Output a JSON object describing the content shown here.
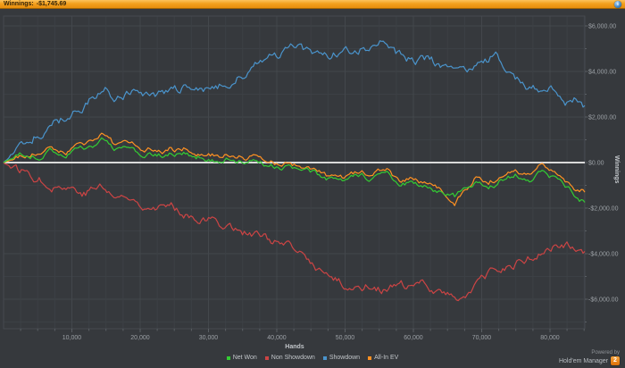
{
  "titlebar": {
    "label": "Winnings:",
    "value": "-$1,745.69"
  },
  "footer": {
    "powered_by": "Powered by",
    "brand": "Hold'em Manager",
    "badge": "2"
  },
  "colors": {
    "background": "#36393d",
    "titlebar_orange": "#f3a01e",
    "grid_minor": "#3c4045",
    "grid_major": "#43474c",
    "plot_border": "#45494e",
    "zero_line": "#d9d9d9",
    "axis_text": "#9ba0a5",
    "tick": "#5a5f64",
    "info_icon_blue": "#3b82c4",
    "badge_orange": "#e8820e"
  },
  "chart_data": {
    "type": "line",
    "title": "Winnings: -$1,745.69",
    "xlabel": "Hands",
    "ylabel": "Winnings",
    "xlim": [
      0,
      85100
    ],
    "ylim": [
      -7295,
      6430
    ],
    "grid": {
      "x_minor_step": 2500,
      "y_minor_step": 1000,
      "grid_on": true
    },
    "legend_position": "bottom-center",
    "zero_line": true,
    "x_ticks": [
      {
        "v": 10000,
        "label": "10,000"
      },
      {
        "v": 20000,
        "label": "20,000"
      },
      {
        "v": 30000,
        "label": "30,000"
      },
      {
        "v": 40000,
        "label": "40,000"
      },
      {
        "v": 50000,
        "label": "50,000"
      },
      {
        "v": 60000,
        "label": "60,000"
      },
      {
        "v": 70000,
        "label": "70,000"
      },
      {
        "v": 80000,
        "label": "80,000"
      }
    ],
    "y_ticks": [
      {
        "v": 6000,
        "label": "$6,000.00"
      },
      {
        "v": 4000,
        "label": "$4,000.00"
      },
      {
        "v": 2000,
        "label": "$2,000.00"
      },
      {
        "v": 0,
        "label": "$0.00"
      },
      {
        "v": -2000,
        "label": "-$2,000.00"
      },
      {
        "v": -4000,
        "label": "-$4,000.00"
      },
      {
        "v": -6000,
        "label": "-$6,000.00"
      }
    ],
    "series": [
      {
        "name": "Net Won",
        "color": "#33cc33",
        "points": [
          [
            0,
            0
          ],
          [
            1500,
            250
          ],
          [
            3000,
            350
          ],
          [
            5000,
            250
          ],
          [
            7000,
            450
          ],
          [
            9000,
            400
          ],
          [
            11000,
            550
          ],
          [
            13000,
            820
          ],
          [
            14500,
            950
          ],
          [
            16000,
            650
          ],
          [
            18000,
            550
          ],
          [
            20000,
            350
          ],
          [
            22000,
            280
          ],
          [
            24000,
            320
          ],
          [
            26000,
            400
          ],
          [
            28000,
            300
          ],
          [
            30000,
            200
          ],
          [
            32000,
            100
          ],
          [
            34000,
            150
          ],
          [
            36000,
            50
          ],
          [
            38000,
            -50
          ],
          [
            40000,
            -150
          ],
          [
            42000,
            -250
          ],
          [
            44000,
            -400
          ],
          [
            46000,
            -550
          ],
          [
            48000,
            -750
          ],
          [
            50000,
            -900
          ],
          [
            52000,
            -600
          ],
          [
            54000,
            -750
          ],
          [
            56000,
            -550
          ],
          [
            58000,
            -850
          ],
          [
            60000,
            -950
          ],
          [
            62000,
            -1050
          ],
          [
            64000,
            -1250
          ],
          [
            66000,
            -1500
          ],
          [
            67500,
            -1250
          ],
          [
            69000,
            -950
          ],
          [
            71000,
            -1050
          ],
          [
            73000,
            -750
          ],
          [
            75000,
            -500
          ],
          [
            77000,
            -650
          ],
          [
            79000,
            -450
          ],
          [
            80500,
            -700
          ],
          [
            82000,
            -950
          ],
          [
            83500,
            -1350
          ],
          [
            85000,
            -1745.69
          ]
        ]
      },
      {
        "name": "Non Showdown",
        "color": "#cc4444",
        "points": [
          [
            0,
            0
          ],
          [
            2000,
            -300
          ],
          [
            4000,
            -500
          ],
          [
            6000,
            -800
          ],
          [
            8000,
            -1000
          ],
          [
            10000,
            -1100
          ],
          [
            12000,
            -1300
          ],
          [
            14000,
            -1020
          ],
          [
            16000,
            -1450
          ],
          [
            18000,
            -1600
          ],
          [
            20000,
            -1750
          ],
          [
            22500,
            -1850
          ],
          [
            25000,
            -2000
          ],
          [
            27500,
            -2250
          ],
          [
            30000,
            -2500
          ],
          [
            32500,
            -2700
          ],
          [
            35000,
            -3000
          ],
          [
            37500,
            -3250
          ],
          [
            40000,
            -3500
          ],
          [
            42500,
            -3900
          ],
          [
            45000,
            -4400
          ],
          [
            47500,
            -5000
          ],
          [
            50000,
            -5400
          ],
          [
            52000,
            -5500
          ],
          [
            54000,
            -5300
          ],
          [
            56000,
            -5600
          ],
          [
            58000,
            -5450
          ],
          [
            60000,
            -5550
          ],
          [
            62000,
            -5350
          ],
          [
            64000,
            -5650
          ],
          [
            66000,
            -5950
          ],
          [
            67500,
            -5800
          ],
          [
            69000,
            -5400
          ],
          [
            71000,
            -5000
          ],
          [
            73000,
            -4700
          ],
          [
            75000,
            -4450
          ],
          [
            77000,
            -4200
          ],
          [
            79000,
            -3950
          ],
          [
            80500,
            -3750
          ],
          [
            82000,
            -3600
          ],
          [
            83500,
            -3800
          ],
          [
            85000,
            -3900
          ]
        ]
      },
      {
        "name": "Showdown",
        "color": "#4a94cc",
        "points": [
          [
            0,
            0
          ],
          [
            2000,
            600
          ],
          [
            4000,
            1100
          ],
          [
            6000,
            1500
          ],
          [
            8000,
            1800
          ],
          [
            10000,
            2100
          ],
          [
            12000,
            2600
          ],
          [
            14000,
            3100
          ],
          [
            15000,
            3250
          ],
          [
            16500,
            2850
          ],
          [
            18000,
            2950
          ],
          [
            20000,
            3100
          ],
          [
            22500,
            2900
          ],
          [
            25000,
            3150
          ],
          [
            27500,
            3400
          ],
          [
            30000,
            3200
          ],
          [
            32500,
            3400
          ],
          [
            34500,
            3800
          ],
          [
            37000,
            4350
          ],
          [
            40000,
            4700
          ],
          [
            42500,
            5000
          ],
          [
            45000,
            4850
          ],
          [
            47500,
            4700
          ],
          [
            50000,
            5000
          ],
          [
            51500,
            4800
          ],
          [
            54000,
            5200
          ],
          [
            55800,
            5600
          ],
          [
            57500,
            4850
          ],
          [
            60000,
            4480
          ],
          [
            62000,
            4600
          ],
          [
            64000,
            4200
          ],
          [
            66000,
            4400
          ],
          [
            68000,
            4100
          ],
          [
            70000,
            4300
          ],
          [
            72000,
            4700
          ],
          [
            73500,
            4200
          ],
          [
            75000,
            3800
          ],
          [
            77000,
            3400
          ],
          [
            79000,
            3200
          ],
          [
            80000,
            3400
          ],
          [
            81500,
            3000
          ],
          [
            83000,
            2550
          ],
          [
            84000,
            2800
          ],
          [
            85000,
            2500
          ]
        ]
      },
      {
        "name": "All-In EV",
        "color": "#ff9122",
        "points": [
          [
            0,
            0
          ],
          [
            1500,
            150
          ],
          [
            3000,
            250
          ],
          [
            5000,
            400
          ],
          [
            7000,
            600
          ],
          [
            9000,
            550
          ],
          [
            11000,
            750
          ],
          [
            13000,
            1050
          ],
          [
            14500,
            1150
          ],
          [
            16000,
            850
          ],
          [
            18000,
            750
          ],
          [
            20000,
            550
          ],
          [
            22000,
            480
          ],
          [
            24000,
            520
          ],
          [
            26000,
            600
          ],
          [
            28000,
            500
          ],
          [
            30000,
            400
          ],
          [
            32000,
            250
          ],
          [
            34000,
            300
          ],
          [
            36000,
            200
          ],
          [
            38000,
            100
          ],
          [
            40000,
            0
          ],
          [
            42000,
            -100
          ],
          [
            44000,
            -250
          ],
          [
            46000,
            -400
          ],
          [
            48000,
            -600
          ],
          [
            50000,
            -750
          ],
          [
            52000,
            -450
          ],
          [
            54000,
            -600
          ],
          [
            56000,
            -400
          ],
          [
            58000,
            -700
          ],
          [
            60000,
            -800
          ],
          [
            62000,
            -900
          ],
          [
            64000,
            -1100
          ],
          [
            66000,
            -1950
          ],
          [
            67500,
            -1350
          ],
          [
            69000,
            -750
          ],
          [
            71000,
            -850
          ],
          [
            73000,
            -550
          ],
          [
            75000,
            -300
          ],
          [
            77000,
            -450
          ],
          [
            79000,
            -150
          ],
          [
            80500,
            -450
          ],
          [
            82000,
            -750
          ],
          [
            83500,
            -1050
          ],
          [
            85000,
            -1300
          ]
        ]
      }
    ]
  }
}
